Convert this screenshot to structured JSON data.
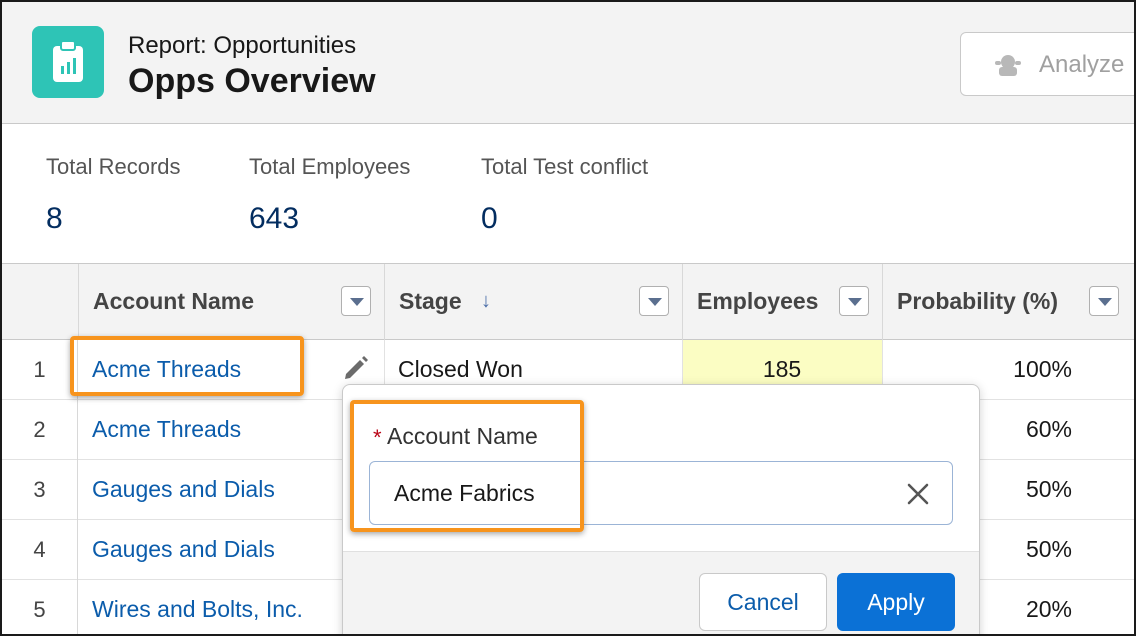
{
  "header": {
    "report_type": "Report: Opportunities",
    "report_name": "Opps Overview",
    "analyze_label": "Analyze"
  },
  "summary": [
    {
      "label": "Total Records",
      "value": "8"
    },
    {
      "label": "Total Employees",
      "value": "643"
    },
    {
      "label": "Total Test conflict",
      "value": "0"
    }
  ],
  "table": {
    "columns": [
      "Account Name",
      "Stage",
      "Employees",
      "Probability (%)"
    ],
    "rows": [
      {
        "num": "1",
        "account": "Acme Threads",
        "stage": "Closed Won",
        "employees": "185",
        "probability": "100%"
      },
      {
        "num": "2",
        "account": "Acme Threads",
        "stage": "",
        "employees": "",
        "probability": "60%"
      },
      {
        "num": "3",
        "account": "Gauges and Dials",
        "stage": "",
        "employees": "",
        "probability": "50%"
      },
      {
        "num": "4",
        "account": "Gauges and Dials",
        "stage": "",
        "employees": "",
        "probability": "50%"
      },
      {
        "num": "5",
        "account": "Wires and Bolts, Inc.",
        "stage": "",
        "employees": "",
        "probability": "20%"
      }
    ]
  },
  "editor": {
    "required_mark": "*",
    "field_label": "Account Name",
    "field_value": "Acme Fabrics",
    "cancel_label": "Cancel",
    "apply_label": "Apply"
  },
  "colors": {
    "brand_teal": "#2ec4b6",
    "link_blue": "#0b5cab",
    "apply_blue": "#0b71d6",
    "highlight_orange": "#f7941d",
    "changed_cell_yellow": "#fbfdc3"
  }
}
